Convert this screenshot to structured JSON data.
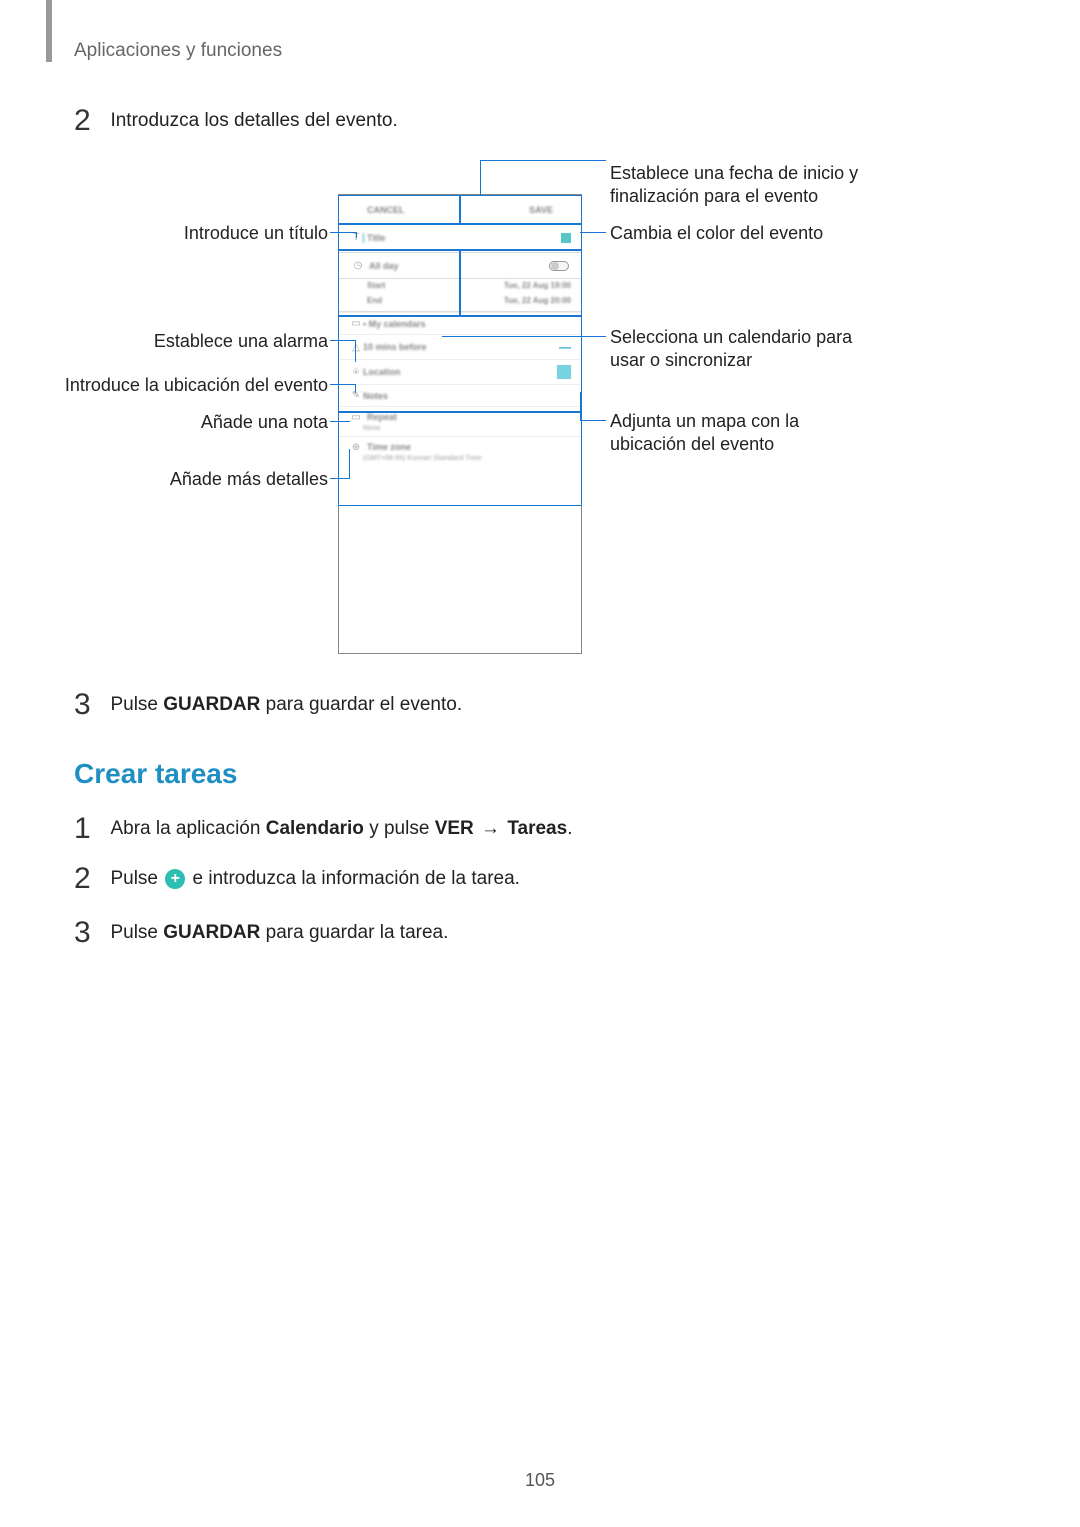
{
  "breadcrumb": "Aplicaciones y funciones",
  "step_top": {
    "num": "2",
    "text": "Introduzca los detalles del evento."
  },
  "step_save_event": {
    "num": "3",
    "pre": "Pulse ",
    "bold": "GUARDAR",
    "post": " para guardar el evento."
  },
  "section_heading": "Crear tareas",
  "task_step1": {
    "num": "1",
    "pre": "Abra la aplicación ",
    "b1": "Calendario",
    "mid": " y pulse ",
    "b2": "VER",
    "arrow": " → ",
    "b3": "Tareas",
    "post": "."
  },
  "task_step2": {
    "num": "2",
    "pre": "Pulse ",
    "post": " e introduzca la información de la tarea."
  },
  "task_step3": {
    "num": "3",
    "pre": "Pulse ",
    "bold": "GUARDAR",
    "post": " para guardar la tarea."
  },
  "callouts": {
    "title": "Introduce un título",
    "alarm": "Establece una alarma",
    "location": "Introduce la ubicación del evento",
    "note": "Añade una nota",
    "more": "Añade más detalles",
    "date": "Establece una fecha de inicio y finalización para el evento",
    "color": "Cambia el color del evento",
    "calendar": "Selecciona un calendario para usar o sincronizar",
    "map": "Adjunta un mapa con la ubicación del evento"
  },
  "figure": {
    "cancel": "CANCEL",
    "save": "SAVE",
    "title_placeholder": "Title",
    "allday": "All day",
    "start": "Start",
    "start_val": "Tue, 22 Aug  19:00",
    "end": "End",
    "end_val": "Tue, 22 Aug  20:00",
    "mycal": "• My calendars",
    "reminder": "10 mins before",
    "location": "Location",
    "notes": "Notes",
    "repeat": "Repeat",
    "repeat_sub": "None",
    "timezone": "Time zone",
    "timezone_sub": "(GMT+09:00) Korean Standard Time"
  },
  "page_number": "105"
}
